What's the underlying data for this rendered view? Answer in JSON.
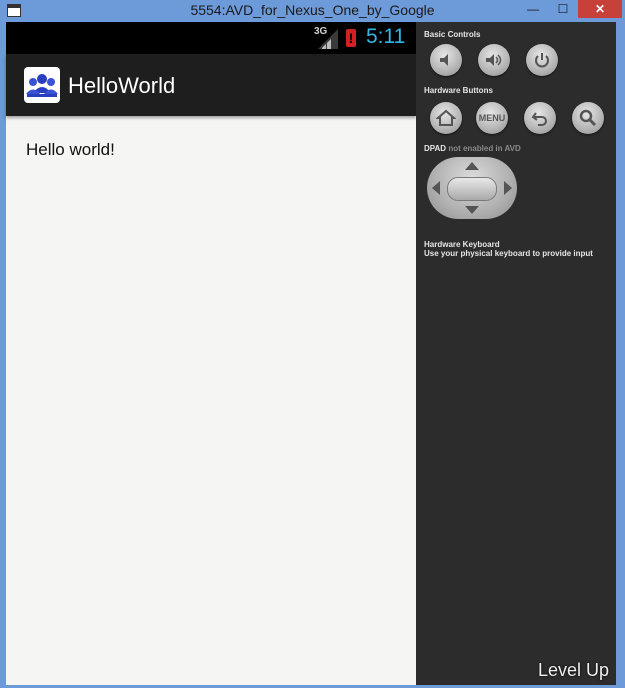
{
  "window": {
    "title": "5554:AVD_for_Nexus_One_by_Google",
    "min_glyph": "—",
    "max_glyph": "☐",
    "close_glyph": "✕"
  },
  "statusbar": {
    "network": "3G",
    "time": "5:11",
    "time_color": "#33b5e5"
  },
  "app": {
    "title": "HelloWorld",
    "icon": "people-group-icon",
    "content_text": "Hello world!"
  },
  "controls": {
    "basic_label": "Basic Controls",
    "basic_buttons": [
      "volume-down-icon",
      "volume-up-icon",
      "power-icon"
    ],
    "hardware_label": "Hardware Buttons",
    "hardware_buttons": [
      "home-icon",
      "menu-button",
      "back-icon",
      "search-icon"
    ],
    "menu_text": "MENU",
    "dpad_label": "DPAD",
    "dpad_note": "not enabled in AVD",
    "keyboard_label": "Hardware Keyboard",
    "keyboard_note": "Use your physical keyboard to provide input"
  },
  "watermark": "Level Up"
}
